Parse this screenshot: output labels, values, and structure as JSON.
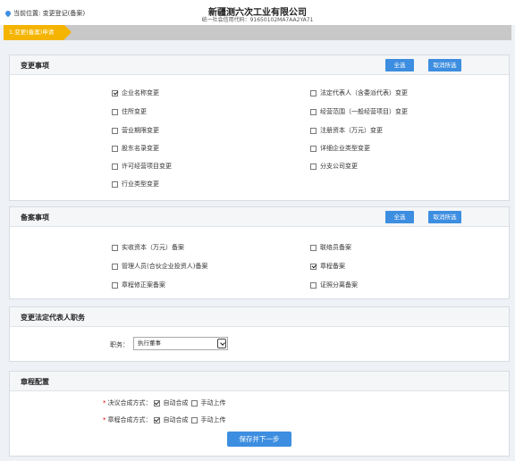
{
  "header": {
    "location": "当前位置: 变更登记(备案)",
    "company": "新疆测六次工业有限公司",
    "credit_code": "统一社会信用代码：91650102MA7AA2YA71"
  },
  "steps": [
    {
      "label": "1.变更(备案)申请"
    }
  ],
  "change_section": {
    "title": "变更事项",
    "select_all": "全选",
    "cancel_select": "取消所选",
    "items": [
      {
        "label": "企业名称变更",
        "checked": true
      },
      {
        "label": "法定代表人（含委派代表）变更",
        "checked": false
      },
      {
        "label": "住所变更",
        "checked": false
      },
      {
        "label": "经营范围（一般经营项目）变更",
        "checked": false
      },
      {
        "label": "营业期限变更",
        "checked": false
      },
      {
        "label": "注册资本（万元）变更",
        "checked": false
      },
      {
        "label": "股东名录变更",
        "checked": false
      },
      {
        "label": "详细企业类型变更",
        "checked": false
      },
      {
        "label": "许可经营项目变更",
        "checked": false
      },
      {
        "label": "分支公司变更",
        "checked": false
      },
      {
        "label": "行业类型变更",
        "checked": false
      }
    ]
  },
  "record_section": {
    "title": "备案事项",
    "select_all": "全选",
    "cancel_select": "取消所选",
    "items": [
      {
        "label": "实收资本（万元）备案",
        "checked": false
      },
      {
        "label": "联络员备案",
        "checked": false
      },
      {
        "label": "管理人员(合伙企业投资人)备案",
        "checked": false
      },
      {
        "label": "章程备案",
        "checked": true
      },
      {
        "label": "章程修正案备案",
        "checked": false
      },
      {
        "label": "证照分离备案",
        "checked": false
      }
    ]
  },
  "legal_rep_section": {
    "title": "变更法定代表人职务",
    "position_label": "职务：",
    "position_value": "执行董事"
  },
  "charter_section": {
    "title": "章程配置",
    "rows": [
      {
        "label": "决议合成方式：",
        "auto": "自动合成",
        "auto_checked": true,
        "manual": "手动上传",
        "manual_checked": false
      },
      {
        "label": "章程合成方式：",
        "auto": "自动合成",
        "auto_checked": true,
        "manual": "手动上传",
        "manual_checked": false
      }
    ]
  },
  "submit_label": "保存并下一步"
}
